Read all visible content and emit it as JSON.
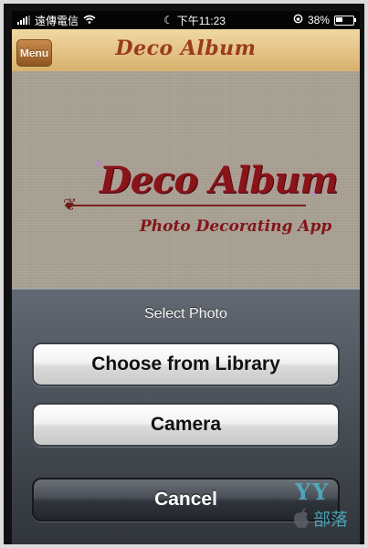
{
  "status_bar": {
    "carrier": "遠傳電信",
    "time": "下午11:23",
    "battery": "38%"
  },
  "nav": {
    "menu_label": "Menu",
    "title": "Deco Album"
  },
  "logo": {
    "title": "Deco Album",
    "subtitle": "Photo Decorating App"
  },
  "sheet": {
    "title": "Select Photo",
    "buttons": {
      "library": "Choose from Library",
      "camera": "Camera",
      "cancel": "Cancel"
    }
  },
  "watermark": {
    "logo": "YY",
    "text": "部落"
  },
  "colors": {
    "nav_bar": "#e2c07f",
    "brand_red": "#b01a20",
    "sheet_bg": "#3c424a",
    "cancel_button": "#2f343b",
    "watermark": "#4fb3c9"
  },
  "icons": [
    "signal-bars-icon",
    "wifi-icon",
    "moon-icon",
    "lock-rotation-icon",
    "battery-icon",
    "flourish-icon",
    "sparkle-icon",
    "apple-icon"
  ]
}
